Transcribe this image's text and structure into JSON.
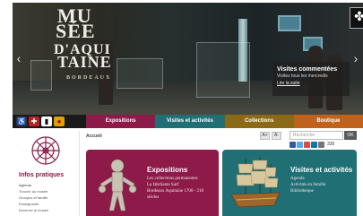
{
  "logo": {
    "line1": "MU",
    "line2": "SÉE",
    "line3": "D'AQUI",
    "line4": "TAINE",
    "line5": "BORDEAUX"
  },
  "hero": {
    "caption_title": "Visites commentées",
    "caption_sub": "Visitez tous les mercredis",
    "caption_link": "Lire la suite",
    "prev_arrow": "‹",
    "next_arrow": "›"
  },
  "utility": {
    "icons": [
      "accessibility-icon",
      "uk-flag-icon",
      "flag-icon",
      "spain-flag-icon"
    ]
  },
  "nav": {
    "items": [
      {
        "label": "Expositions",
        "color": "#8d1a49"
      },
      {
        "label": "Visites et activités",
        "color": "#1f6f75"
      },
      {
        "label": "Collections",
        "color": "#8a6a14"
      },
      {
        "label": "Boutique",
        "color": "#c0621c"
      }
    ]
  },
  "sidebar": {
    "title": "Infos pratiques",
    "links": [
      "Agenda",
      "Trouver au musée",
      "Groupes et famille",
      "Enseignants",
      "Devenez le musée"
    ]
  },
  "main": {
    "breadcrumb": "Accueil",
    "font_small": "A+",
    "font_large": "A-",
    "search_placeholder": "Recherche",
    "search_button": "OK",
    "social_count": "330"
  },
  "cards": {
    "expo": {
      "title": "Expositions",
      "lines": [
        "Les collections permanentes",
        "La fabrilante Sarf",
        "Bordeaux Aquitaine 1700 - 218",
        "siècles"
      ]
    },
    "visit": {
      "title": "Visites et activités",
      "lines": [
        "Agenda",
        "Activités en famille",
        "Bibliothèque"
      ]
    }
  },
  "colors": {
    "accent_purple": "#8d1a49",
    "accent_teal": "#1f6f75",
    "accent_gold": "#8a6a14",
    "accent_orange": "#c0621c"
  }
}
